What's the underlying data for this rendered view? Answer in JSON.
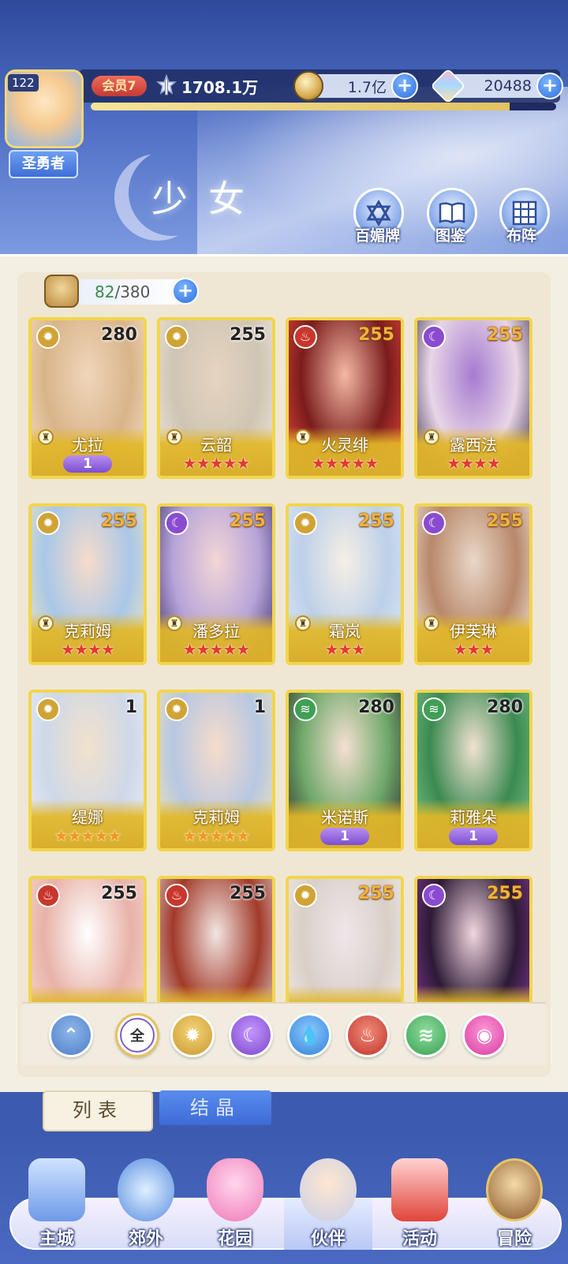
{
  "player": {
    "level": "122",
    "title": "圣勇者",
    "vip": "会员7",
    "power": "1708.1万",
    "xp_fraction": 0.9
  },
  "currency": {
    "gold": "1.7亿",
    "gems": "20488"
  },
  "page": {
    "title": "少女",
    "buttons": [
      {
        "label": "百媚牌",
        "icon": "star-of-david-icon"
      },
      {
        "label": "图鉴",
        "icon": "book-icon"
      },
      {
        "label": "布阵",
        "icon": "grid-icon"
      }
    ]
  },
  "capacity": {
    "current": "82",
    "max": "/380"
  },
  "cards": [
    {
      "name": "尤拉",
      "level": "280",
      "element": "light",
      "level_style": "white",
      "rank": "1"
    },
    {
      "name": "云韶",
      "level": "255",
      "element": "light",
      "level_style": "white",
      "stars": 5,
      "star_color": "red"
    },
    {
      "name": "火灵绯",
      "level": "255",
      "element": "fire",
      "level_style": "orange",
      "stars": 5,
      "star_color": "red"
    },
    {
      "name": "露西法",
      "level": "255",
      "element": "dark",
      "level_style": "orange",
      "stars": 4,
      "star_color": "red"
    },
    {
      "name": "克莉姆",
      "level": "255",
      "element": "light",
      "level_style": "orange",
      "stars": 4,
      "star_color": "red"
    },
    {
      "name": "潘多拉",
      "level": "255",
      "element": "dark",
      "level_style": "orange",
      "stars": 5,
      "star_color": "red"
    },
    {
      "name": "霜岚",
      "level": "255",
      "element": "light",
      "level_style": "orange",
      "stars": 3,
      "star_color": "red"
    },
    {
      "name": "伊芙琳",
      "level": "255",
      "element": "dark",
      "level_style": "orange",
      "stars": 3,
      "star_color": "red"
    },
    {
      "name": "缇娜",
      "level": "1",
      "element": "light",
      "level_style": "white",
      "stars": 5,
      "star_color": "orange"
    },
    {
      "name": "克莉姆",
      "level": "1",
      "element": "light",
      "level_style": "white",
      "stars": 5,
      "star_color": "orange"
    },
    {
      "name": "米诺斯",
      "level": "280",
      "element": "wind",
      "level_style": "white",
      "rank": "1"
    },
    {
      "name": "莉雅朵",
      "level": "280",
      "element": "wind",
      "level_style": "white",
      "rank": "1"
    },
    {
      "name": "",
      "level": "255",
      "element": "fire",
      "level_style": "white"
    },
    {
      "name": "",
      "level": "255",
      "element": "fire",
      "level_style": "white"
    },
    {
      "name": "",
      "level": "255",
      "element": "light",
      "level_style": "orange"
    },
    {
      "name": "",
      "level": "255",
      "element": "dark",
      "level_style": "orange"
    }
  ],
  "filters": {
    "all_label": "全",
    "items": [
      "rank",
      "all",
      "light",
      "dark",
      "water",
      "fire",
      "wind",
      "spirit"
    ],
    "selected": "all"
  },
  "tabs": {
    "list": "列表",
    "crystal": "结晶"
  },
  "nav": [
    {
      "label": "主城",
      "icon": "castle-icon"
    },
    {
      "label": "郊外",
      "icon": "portal-icon"
    },
    {
      "label": "花园",
      "icon": "heart-icon"
    },
    {
      "label": "伙伴",
      "icon": "companion-icon",
      "active": true
    },
    {
      "label": "活动",
      "icon": "gift-icon"
    },
    {
      "label": "冒险",
      "icon": "compass-icon"
    }
  ],
  "colors": {
    "card_border": "#f2d54c",
    "accent_blue": "#2e6fe0",
    "star_red": "#e23a2e",
    "star_orange": "#f29a1e"
  }
}
